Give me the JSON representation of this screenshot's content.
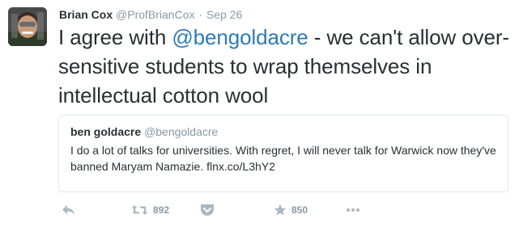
{
  "tweet": {
    "fullname": "Brian Cox",
    "handle": "@ProfBrianCox",
    "separator": "·",
    "time": "Sep 26",
    "text_before": "I agree with ",
    "mention": "@bengoldacre",
    "text_after": " - we can't allow over-sensitive students to wrap themselves in intellectual cotton wool"
  },
  "quote": {
    "fullname": "ben goldacre",
    "handle": "@bengoldacre",
    "text": "I do a lot of talks for universities. With regret, I will never talk for Warwick now they've banned Maryam Namazie. flnx.co/L3hY2"
  },
  "actions": {
    "reply_icon": "reply-icon",
    "retweet_icon": "retweet-icon",
    "retweet_count": "892",
    "pocket_icon": "pocket-icon",
    "favorite_icon": "star-icon",
    "favorite_count": "850",
    "more_icon": "more-dots-icon"
  },
  "colors": {
    "link": "#2b7bb9",
    "muted": "#8899a6",
    "icon": "#aab8c2",
    "border": "#e1e8ed",
    "text": "#292f33"
  }
}
